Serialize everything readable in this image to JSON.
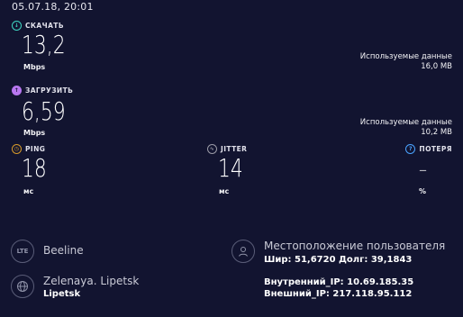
{
  "datetime": "05.07.18, 20:01",
  "download": {
    "label": "СКАЧАТЬ",
    "value": "13,2",
    "unit": "Mbps",
    "used_label": "Используемые данные",
    "used_value": "16,0 MB"
  },
  "upload": {
    "label": "ЗАГРУЗИТЬ",
    "value": "6,59",
    "unit": "Mbps",
    "used_label": "Используемые данные",
    "used_value": "10,2 MB"
  },
  "ping": {
    "label": "PING",
    "value": "18",
    "unit": "мс"
  },
  "jitter": {
    "label": "JITTER",
    "value": "14",
    "unit": "мс"
  },
  "loss": {
    "label": "ПОТЕРЯ",
    "value": "–",
    "unit": "%"
  },
  "provider": {
    "icon_text": "LTE",
    "name": "Beeline"
  },
  "server": {
    "name": "Zelenaya. Lipetsk",
    "city": "Lipetsk"
  },
  "location": {
    "title": "Местоположение пользователя",
    "coords": "Шир: 51,6720 Долг: 39,1843"
  },
  "ip": {
    "internal": "Внутренний_IP: 10.69.185.35",
    "external": "Внешний_IP: 217.118.95.112"
  },
  "colors": {
    "background": "#121430",
    "download": "#3fd6c2",
    "upload": "#b877f0",
    "ping": "#d79a2a",
    "loss": "#4aa3ff"
  },
  "icons": {
    "download": "arrow-down-circle-icon",
    "upload": "arrow-up-circle-icon",
    "ping": "ping-icon",
    "jitter": "jitter-icon",
    "loss": "question-icon",
    "provider": "lte-icon",
    "server": "globe-icon",
    "location": "user-icon"
  }
}
